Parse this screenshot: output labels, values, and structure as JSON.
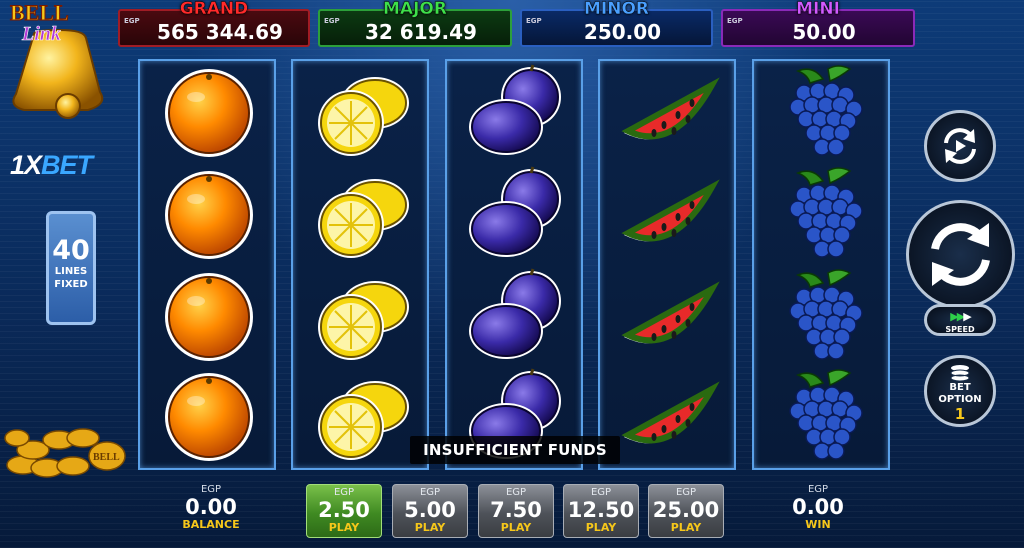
{
  "jackpots": [
    {
      "name": "GRAND",
      "currency": "EGP",
      "value": "565 344.69"
    },
    {
      "name": "MAJOR",
      "currency": "EGP",
      "value": "32 619.49"
    },
    {
      "name": "MINOR",
      "currency": "EGP",
      "value": "250.00"
    },
    {
      "name": "MINI",
      "currency": "EGP",
      "value": "50.00"
    }
  ],
  "logo": {
    "game_line1": "BELL",
    "game_line2": "Link",
    "brand_prefix": "1X",
    "brand_suffix": "BET",
    "coin_text": "BELL Link"
  },
  "lines": {
    "count": "40",
    "label1": "LINES",
    "label2": "FIXED"
  },
  "reels": [
    [
      "orange",
      "orange",
      "orange",
      "orange"
    ],
    [
      "lemon",
      "lemon",
      "lemon",
      "lemon"
    ],
    [
      "plum",
      "plum",
      "plum",
      "plum"
    ],
    [
      "watermelon",
      "watermelon",
      "watermelon",
      "watermelon"
    ],
    [
      "grapes",
      "grapes",
      "grapes",
      "grapes"
    ]
  ],
  "message": "INSUFFICIENT FUNDS",
  "controls": {
    "speed_label": "SPEED",
    "bet_option_line1": "BET",
    "bet_option_line2": "OPTION",
    "bet_option_value": "1"
  },
  "balance": {
    "currency": "EGP",
    "value": "0.00",
    "label": "BALANCE"
  },
  "win": {
    "currency": "EGP",
    "value": "0.00",
    "label": "WIN"
  },
  "bets": [
    {
      "currency": "EGP",
      "value": "2.50",
      "label": "PLAY",
      "selected": true
    },
    {
      "currency": "EGP",
      "value": "5.00",
      "label": "PLAY",
      "selected": false
    },
    {
      "currency": "EGP",
      "value": "7.50",
      "label": "PLAY",
      "selected": false
    },
    {
      "currency": "EGP",
      "value": "12.50",
      "label": "PLAY",
      "selected": false
    },
    {
      "currency": "EGP",
      "value": "25.00",
      "label": "PLAY",
      "selected": false
    }
  ],
  "colors": {
    "grand": "#ff2a2a",
    "major": "#3ee04a",
    "minor": "#4aa0ff",
    "mini": "#d15aff",
    "accent_gold": "#f6c71a",
    "active_bet": "#3f8a22"
  }
}
